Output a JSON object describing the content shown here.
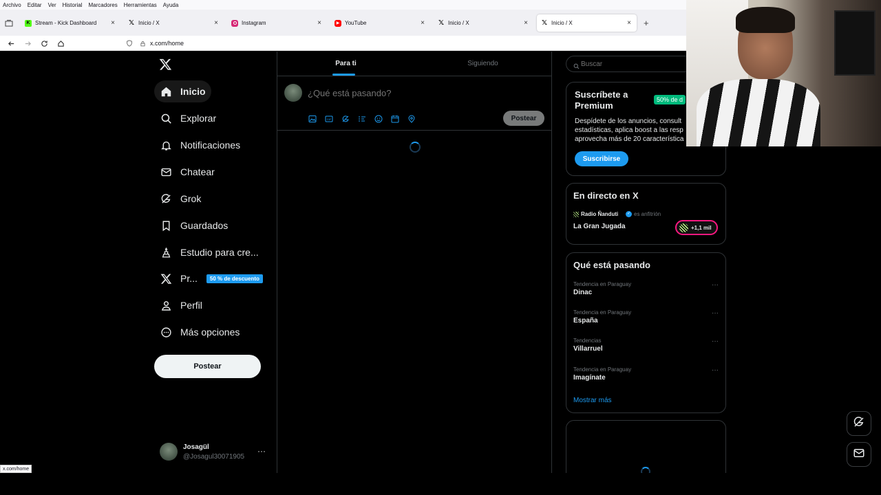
{
  "browser": {
    "menu": [
      "Archivo",
      "Editar",
      "Ver",
      "Historial",
      "Marcadores",
      "Herramientas",
      "Ayuda"
    ],
    "tabs": [
      {
        "title": "Stream - Kick Dashboard",
        "favicon": "kick-icon",
        "color": "#53fc18"
      },
      {
        "title": "Inicio / X",
        "favicon": "x-icon",
        "color": "#000000"
      },
      {
        "title": "Instagram",
        "favicon": "instagram-icon",
        "color": "#d62976"
      },
      {
        "title": "YouTube",
        "favicon": "youtube-icon",
        "color": "#ff0000"
      },
      {
        "title": "Inicio / X",
        "favicon": "x-icon",
        "color": "#000000"
      },
      {
        "title": "Inicio / X",
        "favicon": "x-icon",
        "color": "#000000",
        "active": true
      }
    ],
    "url": "x.com/home",
    "status_url": "x.com/home"
  },
  "sidebar": {
    "items": [
      {
        "label": "Inicio",
        "icon": "home-icon"
      },
      {
        "label": "Explorar",
        "icon": "search-icon"
      },
      {
        "label": "Notificaciones",
        "icon": "bell-icon"
      },
      {
        "label": "Chatear",
        "icon": "mail-icon"
      },
      {
        "label": "Grok",
        "icon": "grok-icon"
      },
      {
        "label": "Guardados",
        "icon": "bookmark-icon"
      },
      {
        "label": "Estudio para cre...",
        "icon": "creator-studio-icon"
      },
      {
        "label": "Pr...",
        "icon": "x-premium-icon",
        "badge": "50 % de descuento"
      },
      {
        "label": "Perfil",
        "icon": "person-icon"
      },
      {
        "label": "Más opciones",
        "icon": "more-circle-icon"
      }
    ],
    "post_button": "Postear",
    "account": {
      "name": "Josagül",
      "handle": "@Josagul30071905"
    }
  },
  "main": {
    "tabs": [
      "Para ti",
      "Siguiendo"
    ],
    "composer_placeholder": "¿Qué está pasando?",
    "post_button": "Postear"
  },
  "right": {
    "search_placeholder": "Buscar",
    "premium": {
      "title": "Suscríbete a Premium",
      "badge": "50% de d",
      "text": "Despídete de los anuncios, consult estadísticas, aplica boost a las resp aprovecha más de 20 característica",
      "button": "Suscribirse"
    },
    "live": {
      "title": "En directo en X",
      "host": "Radio Ñanduti",
      "host_suffix": "es anfitrión",
      "show": "La Gran Jugada",
      "listeners": "+1,1 mil"
    },
    "trends": {
      "title": "Qué está pasando",
      "items": [
        {
          "category": "Tendencia en Paraguay",
          "name": "Dinac"
        },
        {
          "category": "Tendencia en Paraguay",
          "name": "España"
        },
        {
          "category": "Tendencias",
          "name": "Villarruel"
        },
        {
          "category": "Tendencia en Paraguay",
          "name": "Imagínate"
        }
      ],
      "show_more": "Mostrar más"
    }
  },
  "colors": {
    "accent": "#1d9bf0",
    "premium_badge": "#00ba7c",
    "live_pink": "#f91880"
  }
}
